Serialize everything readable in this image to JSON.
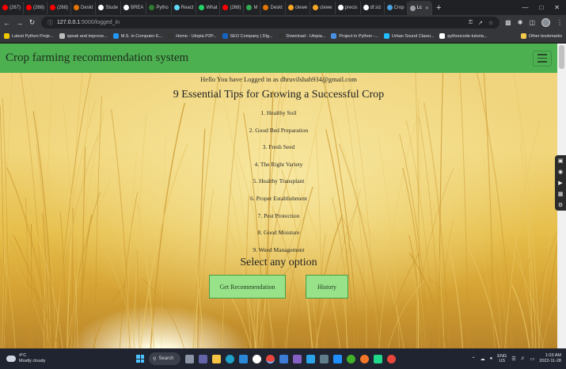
{
  "browser": {
    "tabs": [
      {
        "label": "(267)",
        "color": "#ff0000"
      },
      {
        "label": "(268)",
        "color": "#ff0000"
      },
      {
        "label": "(268)",
        "color": "#ff0000"
      },
      {
        "label": "Deskt",
        "color": "#e37400"
      },
      {
        "label": "Stude",
        "color": "#ffffff"
      },
      {
        "label": "BREA",
        "color": "#ffffff"
      },
      {
        "label": "Pytho",
        "color": "#2e7d32"
      },
      {
        "label": "React",
        "color": "#61dafb"
      },
      {
        "label": "What",
        "color": "#25d366"
      },
      {
        "label": "(268)",
        "color": "#ff0000"
      },
      {
        "label": "M",
        "color": "#34a853"
      },
      {
        "label": "Deskt",
        "color": "#e37400"
      },
      {
        "label": "clewe",
        "color": "#f9a825"
      },
      {
        "label": "clewe",
        "color": "#f9a825"
      },
      {
        "label": "precis",
        "color": "#ffffff"
      },
      {
        "label": "df.siz",
        "color": "#ffffff"
      },
      {
        "label": "Crop",
        "color": "#4aa3df"
      },
      {
        "label": "Lc",
        "color": "#9aa0a6"
      }
    ],
    "active_tab": "Lc",
    "new_tab": "+",
    "url_host": "127.0.0.1",
    "url_rest": ":5000/logged_in",
    "bookmarks": [
      {
        "label": "Latest Python Proje...",
        "color": "#f0c800"
      },
      {
        "label": "speak and improve...",
        "color": "#bdbdbd"
      },
      {
        "label": "M.S. in Computer E...",
        "color": "#2196f3"
      },
      {
        "label": "Home - Utopia P2P...",
        "color": "#333333"
      },
      {
        "label": "SEO Company | Dig...",
        "color": "#1565c0"
      },
      {
        "label": "Download - Utopia...",
        "color": "#333333"
      },
      {
        "label": "Project in Python -...",
        "color": "#4a90e2"
      },
      {
        "label": "Urban Sound Classi...",
        "color": "#20beff"
      },
      {
        "label": "pythoncode-tutoria...",
        "color": "#ffffff"
      }
    ],
    "other_bookmarks": "Other bookmarks"
  },
  "app": {
    "brand": "Crop farming recommendation system",
    "greeting": "Hello You have Logged in as dhruvilshah934@gmail.com",
    "tips_title": "9 Essential Tips for Growing a Successful Crop",
    "tips": [
      "1. Healthy Soil",
      "2. Good Bed Preparation",
      "3. Fresh Seed",
      "4. The Right Variety",
      "5. Healthy Transplant",
      "6. Proper Establishment",
      "7. Pest Protection",
      "8. Good Moisture",
      "9. Weed Management"
    ],
    "select_title": "Select any option",
    "recommendation_button": "Get Recommendation",
    "history_button": "History",
    "navbar_color": "#4caf50",
    "button_color": "#98e38a"
  },
  "taskbar": {
    "temperature": "4°C",
    "weather": "Mostly cloudy",
    "search": "Search",
    "lang_top": "ENG",
    "lang_bottom": "US",
    "time": "1:03 AM",
    "date": "2022-11-28"
  }
}
